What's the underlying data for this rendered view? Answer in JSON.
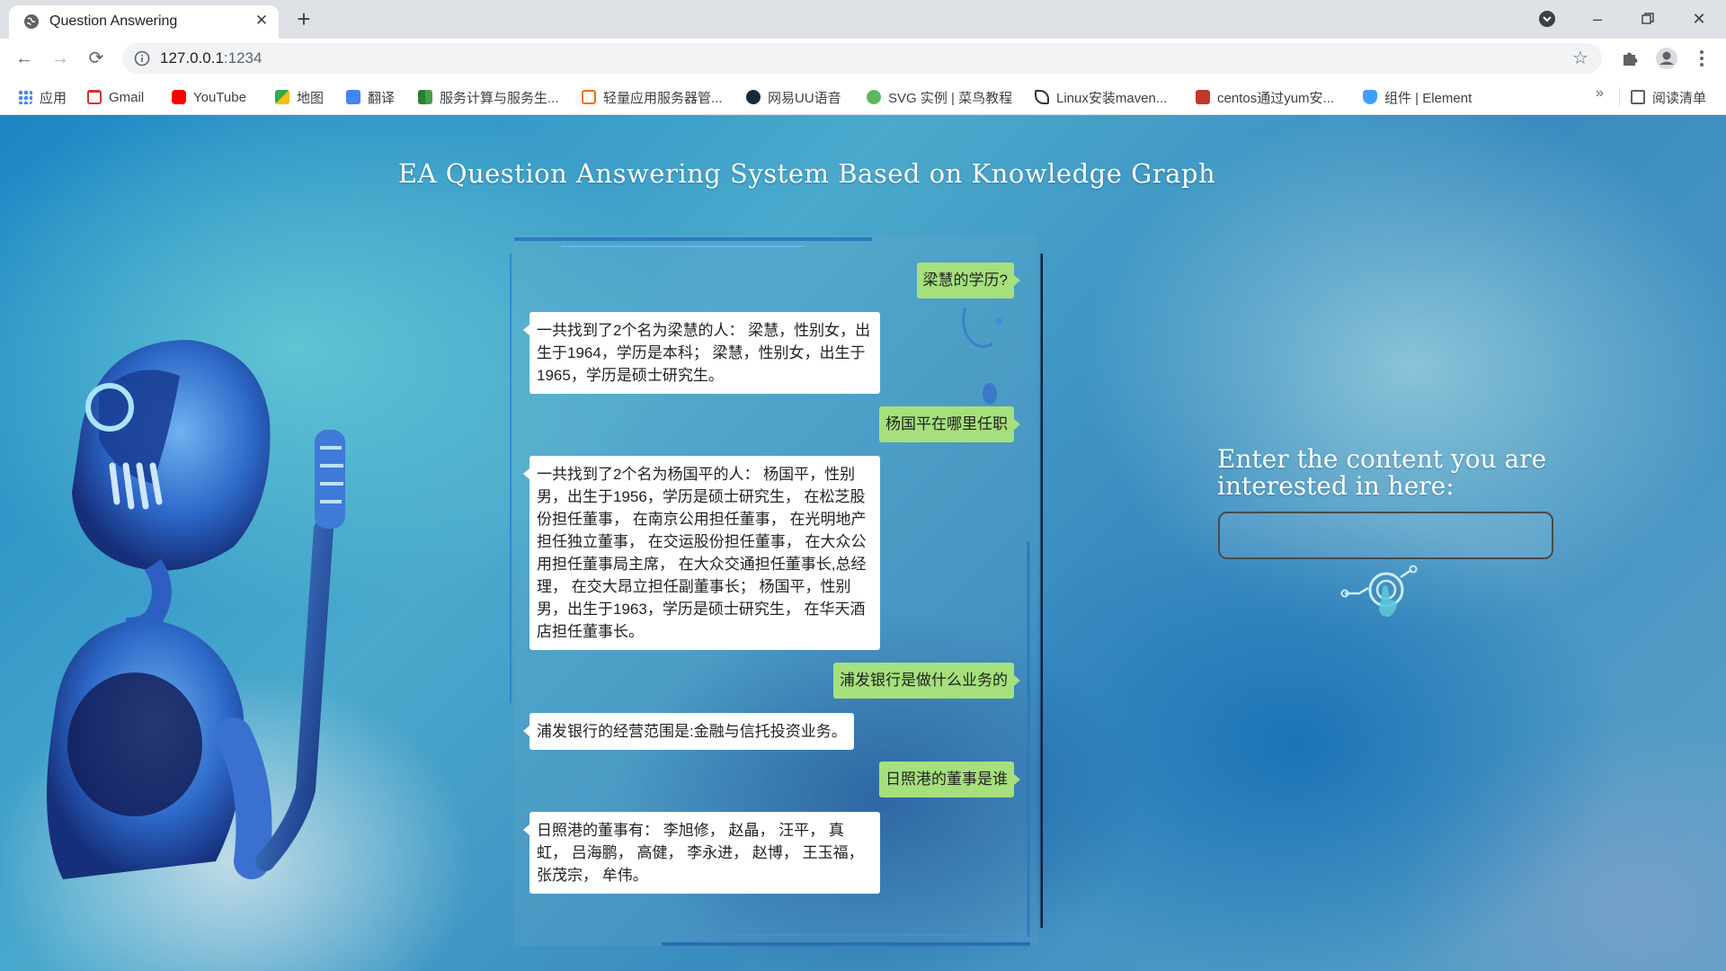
{
  "browser": {
    "tab_title": "Question Answering",
    "tab_close": "✕",
    "new_tab": "+",
    "address_host": "127.0.0.1",
    "address_port": ":1234",
    "bookmarks": [
      {
        "label": "应用",
        "icon": "apps-grid-icon",
        "color": "#4285f4"
      },
      {
        "label": "Gmail",
        "icon": "gmail-icon",
        "color": "#d93025"
      },
      {
        "label": "YouTube",
        "icon": "youtube-icon",
        "color": "#ff0000"
      },
      {
        "label": "地图",
        "icon": "maps-icon",
        "color": "#34a853"
      },
      {
        "label": "翻译",
        "icon": "translate-icon",
        "color": "#4285f4"
      },
      {
        "label": "服务计算与服务生...",
        "icon": "book-icon",
        "color": "#2e7d32"
      },
      {
        "label": "轻量应用服务器管...",
        "icon": "cloud-server-icon",
        "color": "#ff6a00"
      },
      {
        "label": "网易UU语音",
        "icon": "uu-voice-icon",
        "color": "#1a2a3a"
      },
      {
        "label": "SVG 实例 | 菜鸟教程",
        "icon": "runoob-icon",
        "color": "#5cb85c"
      },
      {
        "label": "Linux安装maven...",
        "icon": "feather-icon",
        "color": "#333333"
      },
      {
        "label": "centos通过yum安...",
        "icon": "blog-icon",
        "color": "#c0392b"
      },
      {
        "label": "组件 | Element",
        "icon": "element-icon",
        "color": "#409eff"
      }
    ],
    "bookmarks_more": "»",
    "reading_list": "阅读清单"
  },
  "page": {
    "title": "EA Question Answering System Based on Knowledge Graph",
    "input_label": "Enter the content you are interested in here:",
    "input_value": "",
    "accent_user_bubble": "#a6e07c"
  },
  "chat": [
    {
      "role": "user",
      "text": "梁慧的学历?"
    },
    {
      "role": "bot",
      "text": "一共找到了2个名为梁慧的人： 梁慧，性别女，出生于1964，学历是本科； 梁慧，性别女，出生于1965，学历是硕士研究生。"
    },
    {
      "role": "user",
      "text": "杨国平在哪里任职"
    },
    {
      "role": "bot",
      "text": "一共找到了2个名为杨国平的人： 杨国平，性别男，出生于1956，学历是硕士研究生， 在松芝股份担任董事， 在南京公用担任董事， 在光明地产担任独立董事， 在交运股份担任董事， 在大众公用担任董事局主席， 在大众交通担任董事长,总经理， 在交大昂立担任副董事长； 杨国平，性别男，出生于1963，学历是硕士研究生， 在华天酒店担任董事长。"
    },
    {
      "role": "user",
      "text": "浦发银行是做什么业务的"
    },
    {
      "role": "bot",
      "text": "浦发银行的经营范围是:金融与信托投资业务。"
    },
    {
      "role": "user",
      "text": "日照港的董事是谁"
    },
    {
      "role": "bot",
      "text": "日照港的董事有： 李旭修， 赵晶， 汪平， 真虹， 吕海鹏， 高健， 李永进， 赵博， 王玉福， 张茂宗， 牟伟。"
    }
  ]
}
